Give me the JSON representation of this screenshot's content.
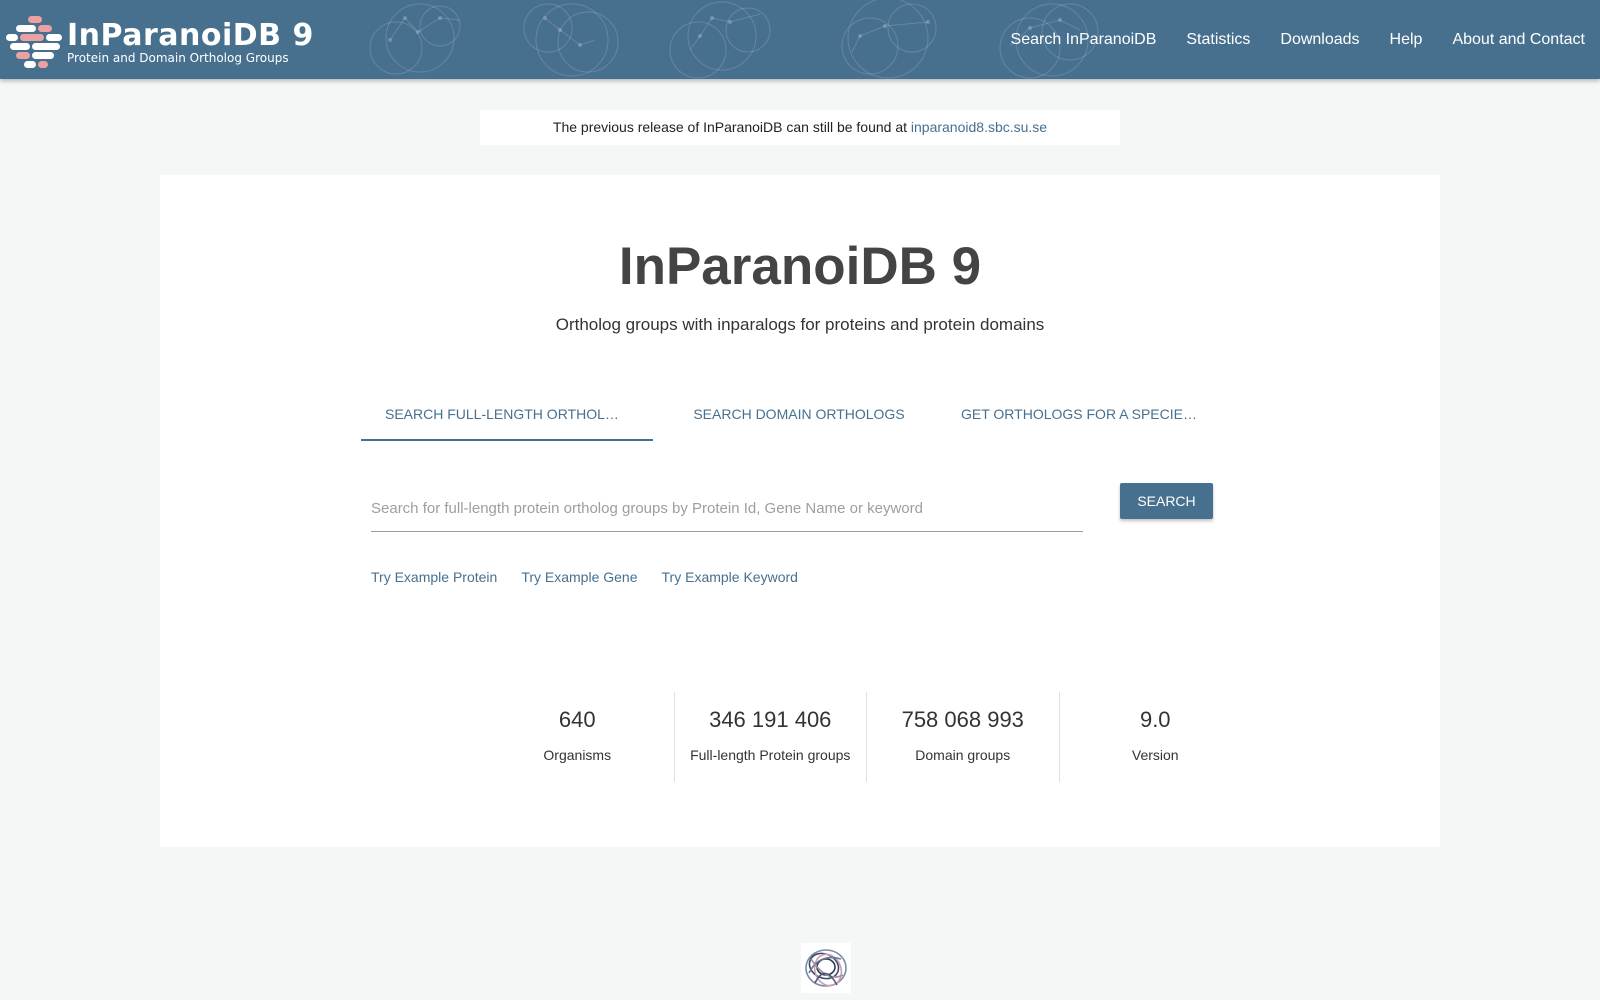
{
  "brand": {
    "title": "InParanoiDB 9",
    "subtitle": "Protein and Domain Ortholog Groups",
    "logo_icon": "inparanoid-logo-icon"
  },
  "nav": {
    "items": [
      {
        "label": "Search InParanoiDB"
      },
      {
        "label": "Statistics"
      },
      {
        "label": "Downloads"
      },
      {
        "label": "Help"
      },
      {
        "label": "About and Contact"
      }
    ]
  },
  "notice": {
    "text": "The previous release of InParanoiDB can still be found at ",
    "link_text": "inparanoid8.sbc.su.se"
  },
  "main": {
    "title": "InParanoiDB 9",
    "subtitle": "Ortholog groups with inparalogs for proteins and protein domains",
    "tabs": [
      {
        "label": "Search full-length orthol…",
        "active": true
      },
      {
        "label": "Search domain orthologs",
        "active": false
      },
      {
        "label": "Get orthologs for a specie…",
        "active": false
      }
    ],
    "search": {
      "value": "",
      "placeholder": "Search for full-length protein ortholog groups by Protein Id, Gene Name or keyword",
      "button_label": "Search"
    },
    "examples": [
      {
        "label": "Try Example Protein"
      },
      {
        "label": "Try Example Gene"
      },
      {
        "label": "Try Example Keyword"
      }
    ],
    "stats": [
      {
        "value": "640",
        "label": "Organisms"
      },
      {
        "value": "346 191 406",
        "label": "Full-length Protein groups"
      },
      {
        "value": "758 068 993",
        "label": "Domain groups"
      },
      {
        "value": "9.0",
        "label": "Version"
      }
    ]
  },
  "colors": {
    "primary": "#47708f",
    "accent": "#eba1a1",
    "background": "#f5f6f6"
  },
  "footer": {
    "logo_icon": "footer-logo-icon"
  }
}
